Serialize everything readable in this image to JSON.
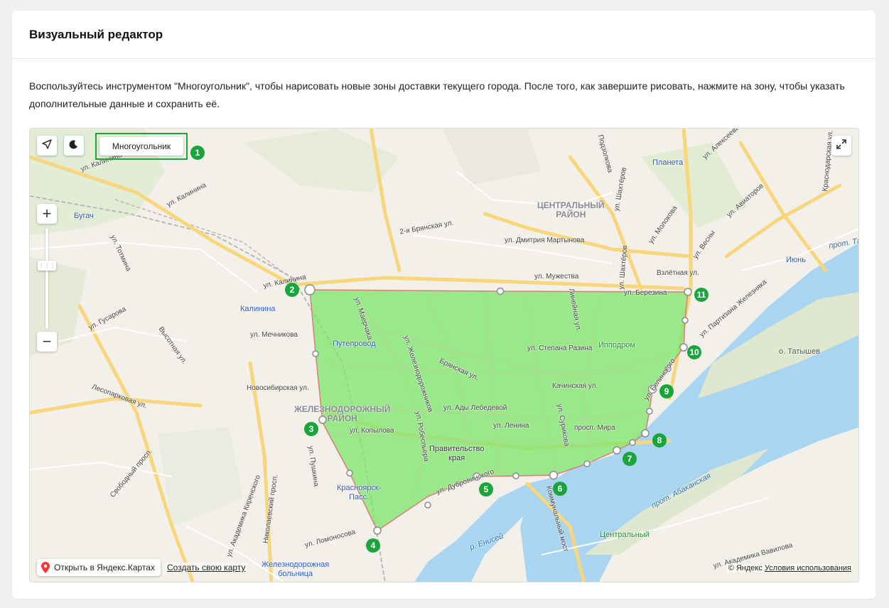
{
  "header": {
    "title": "Визуальный редактор"
  },
  "description": "Воспользуйтесь инструментом \"Многоугольник\", чтобы нарисовать новые зоны доставки текущего города. После того, как завершите рисовать, нажмите на зону, чтобы указать дополнительные данные и сохранить её.",
  "map": {
    "polygon_button_label": "Многоугольник",
    "open_yandex_label": "Открыть в Яндекс.Картах",
    "create_map_label": "Создать свою карту",
    "copyright_text": "© Яндекс",
    "terms_link": "Условия использования",
    "zoom_in": "+",
    "zoom_out": "−",
    "badges": [
      "1",
      "2",
      "3",
      "4",
      "5",
      "6",
      "7",
      "8",
      "9",
      "10",
      "11"
    ],
    "districts": {
      "central": "ЦЕНТРАЛЬНЫЙ\nРАЙОН",
      "railway": "ЖЕЛЕЗНОДОРОЖНЫЙ\nРАЙОН"
    },
    "pois": {
      "bugach": "Бугач",
      "kalinina": "Калинина",
      "putevod": "Путепровод",
      "planeta": "Планета",
      "iyun": "Июнь",
      "ippodrom": "Ипподром",
      "vzletnaya": "Взлётная ул.",
      "pravitelstvo": "Правительство\nкрая",
      "krasnoyarsk_pass": "Красноярск-\nПасс.",
      "tsentralny": "Центральный",
      "zhd_bolnitsa": "Железнодорожная\nбольница",
      "tatyshev": "о. Татышев",
      "yenisei": "р. Енисей",
      "abakanskaya": "прот. Абаканская",
      "prot_tat": "прот. Тат"
    },
    "streets": [
      "ул. Калинина",
      "ул. Калинина",
      "ул. Калинина",
      "ул. Тотмина",
      "ул. Гусарова",
      "Высотная ул.",
      "Лесопарковая ул.",
      "Свободный просп.",
      "ул. Академика Киренского",
      "Николаевский просп.",
      "ул. Академика Вавилова",
      "ул. Ломоносова",
      "ул. Пушкина",
      "ул. Копылова",
      "Новосибирская ул.",
      "ул. Мечникова",
      "ул. Маерчака",
      "ул. Железнодорожников",
      "ул. Робеспьера",
      "Брянская ул.",
      "2-я Брянская ул.",
      "ул. Дмитрия Мартынова",
      "ул. Мужества",
      "ул. Березина",
      "ул. Шахтёров",
      "ул. Шахтёров",
      "Подзолкова",
      "Линейная ул.",
      "ул. Степана Разина",
      "Качинская ул.",
      "ул. Ады Лебедевой",
      "ул. Ленина",
      "ул. Сурикова",
      "просп. Мира",
      "ул. Белинского",
      "ул. Партизана Железняка",
      "ул. Молокова",
      "ул. Весны",
      "ул. Авиаторов",
      "ул. Алексеева",
      "ул. Дубровинского",
      "Коммунальный мост",
      "Краснодарская ул.",
      "ул. Партизана Железняка"
    ]
  }
}
